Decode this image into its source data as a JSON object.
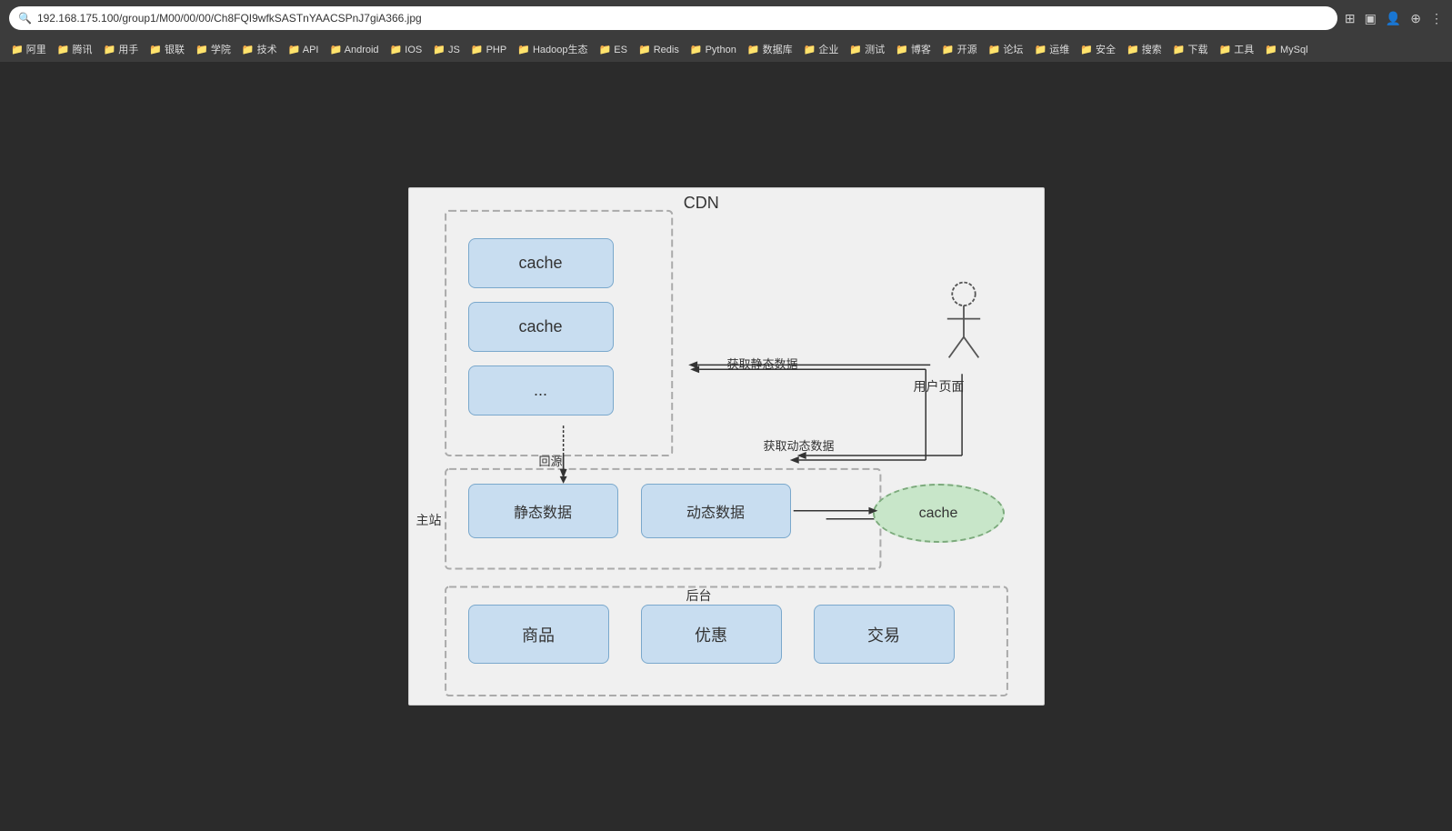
{
  "browser": {
    "address": "192.168.175.100/group1/M00/00/00/Ch8FQI9wfkSASTnYAACSPnJ7giA366.jpg",
    "bookmarks": [
      "阿里",
      "腾讯",
      "用手",
      "银联",
      "学院",
      "技术",
      "API",
      "Android",
      "IOS",
      "JS",
      "PHP",
      "Hadoop生态",
      "ES",
      "Redis",
      "Python",
      "数据库",
      "企业",
      "测试",
      "博客",
      "开源",
      "论坛",
      "运维",
      "安全",
      "搜索",
      "下载",
      "工具",
      "MySql"
    ]
  },
  "diagram": {
    "cdn_label": "CDN",
    "cache1": "cache",
    "cache2": "cache",
    "cache_dots": "...",
    "huiyuan_label": "回源",
    "zhuzhan_label": "主站",
    "static_data_label": "静态数据",
    "dynamic_data_label": "动态数据",
    "cache_ellipse_label": "cache",
    "houtai_label": "后台",
    "product_label": "商品",
    "discount_label": "优惠",
    "trade_label": "交易",
    "user_page_label": "用户页面",
    "get_static_label": "获取静态数据",
    "get_dynamic_label": "获取动态数据"
  }
}
